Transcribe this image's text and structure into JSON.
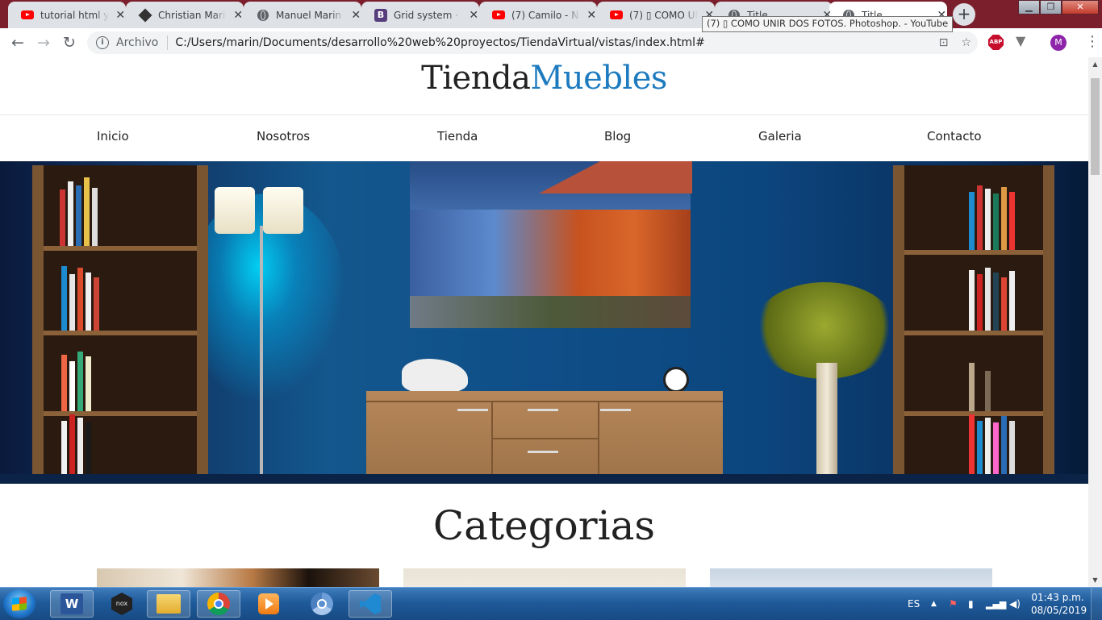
{
  "browser": {
    "tabs": [
      {
        "title": "tutorial html y c",
        "icon": "youtube-icon"
      },
      {
        "title": "Christian Marin",
        "icon": "codepen-icon"
      },
      {
        "title": "Manuel Marin A",
        "icon": "globe-icon"
      },
      {
        "title": "Grid system · Bo",
        "icon": "bootstrap-icon"
      },
      {
        "title": "(7) Camilo - No",
        "icon": "youtube-icon"
      },
      {
        "title": "(7) ▯ COMO UN",
        "icon": "youtube-icon"
      },
      {
        "title": "Title",
        "icon": "globe-icon"
      },
      {
        "title": "Title",
        "icon": "globe-icon",
        "active": true
      }
    ],
    "tooltip": "(7) ▯ COMO UNIR DOS FOTOS. Photoshop. - YouTube",
    "address": {
      "scheme_label": "Archivo",
      "url": "C:/Users/marin/Documents/desarrollo%20web%20proyectos/TiendaVirtual/vistas/index.html#"
    },
    "extensions": {
      "abp_label": "ABP",
      "avatar_letter": "M"
    }
  },
  "page": {
    "brand_part1": "Tienda",
    "brand_part2": "Muebles",
    "nav": [
      "Inicio",
      "Nosotros",
      "Tienda",
      "Blog",
      "Galeria",
      "Contacto"
    ],
    "section_title": "Categorias"
  },
  "taskbar": {
    "apps": [
      "word",
      "nox",
      "file-explorer",
      "chrome",
      "media-player",
      "chromium",
      "vscode"
    ],
    "language": "ES",
    "time": "01:43 p.m.",
    "date": "08/05/2019"
  },
  "colors": {
    "brand_accent": "#1e7bbf",
    "tabstrip": "#7b1f2c",
    "taskbar": "#1f5a9a"
  }
}
